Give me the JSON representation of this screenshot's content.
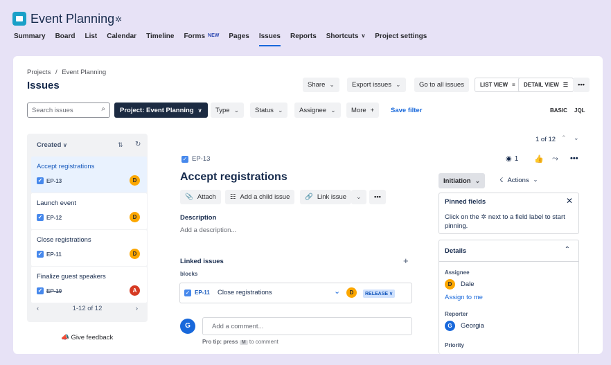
{
  "header": {
    "project_title": "Event Planning",
    "nav": [
      {
        "label": "Summary"
      },
      {
        "label": "Board"
      },
      {
        "label": "List"
      },
      {
        "label": "Calendar"
      },
      {
        "label": "Timeline"
      },
      {
        "label": "Forms",
        "badge": "NEW"
      },
      {
        "label": "Pages"
      },
      {
        "label": "Issues"
      },
      {
        "label": "Reports"
      },
      {
        "label": "Shortcuts"
      },
      {
        "label": "Project settings"
      }
    ]
  },
  "page": {
    "breadcrumb_projects": "Projects",
    "breadcrumb_sep": "/",
    "breadcrumb_project": "Event Planning",
    "title": "Issues"
  },
  "toolbar": {
    "share": "Share",
    "export": "Export issues",
    "go_all": "Go to all issues",
    "list_view": "LIST VIEW",
    "detail_view": "DETAIL VIEW",
    "more": "•••"
  },
  "filters": {
    "search_placeholder": "Search issues",
    "project": "Project: Event Planning",
    "type": "Type",
    "status": "Status",
    "assignee": "Assignee",
    "more": "More",
    "save": "Save filter",
    "basic": "BASIC",
    "jql": "JQL"
  },
  "list_panel": {
    "sort_label": "Created",
    "items": [
      {
        "title": "Accept registrations",
        "key": "EP-13",
        "avatar": "D"
      },
      {
        "title": "Launch event",
        "key": "EP-12",
        "avatar": "D"
      },
      {
        "title": "Close registrations",
        "key": "EP-11",
        "avatar": "D"
      },
      {
        "title": "Finalize guest speakers",
        "key": "EP-10",
        "avatar": "A"
      }
    ],
    "pagination": "1-12 of 12",
    "feedback": "Give feedback"
  },
  "issue": {
    "counter": "1 of 12",
    "key": "EP-13",
    "title": "Accept registrations",
    "watchers": "1",
    "attach": "Attach",
    "add_child": "Add a child issue",
    "link_issue": "Link issue",
    "description_label": "Description",
    "description_placeholder": "Add a description...",
    "linked_label": "Linked issues",
    "link_type": "blocks",
    "linked": {
      "key": "EP-11",
      "title": "Close registrations",
      "avatar": "D",
      "status": "RELEASE"
    },
    "comment_avatar": "G",
    "comment_placeholder": "Add a comment...",
    "tip_prefix": "Pro tip: press",
    "tip_key": "M",
    "tip_suffix": "to comment"
  },
  "side": {
    "status_btn": "Initiation",
    "actions": "Actions",
    "pinned_title": "Pinned fields",
    "pinned_text": "Click on the ✲ next to a field label to start pinning.",
    "details_title": "Details",
    "assignee_label": "Assignee",
    "assignee_name": "Dale",
    "assignee_avatar": "D",
    "assign_me": "Assign to me",
    "reporter_label": "Reporter",
    "reporter_name": "Georgia",
    "reporter_avatar": "G",
    "priority_label": "Priority"
  }
}
